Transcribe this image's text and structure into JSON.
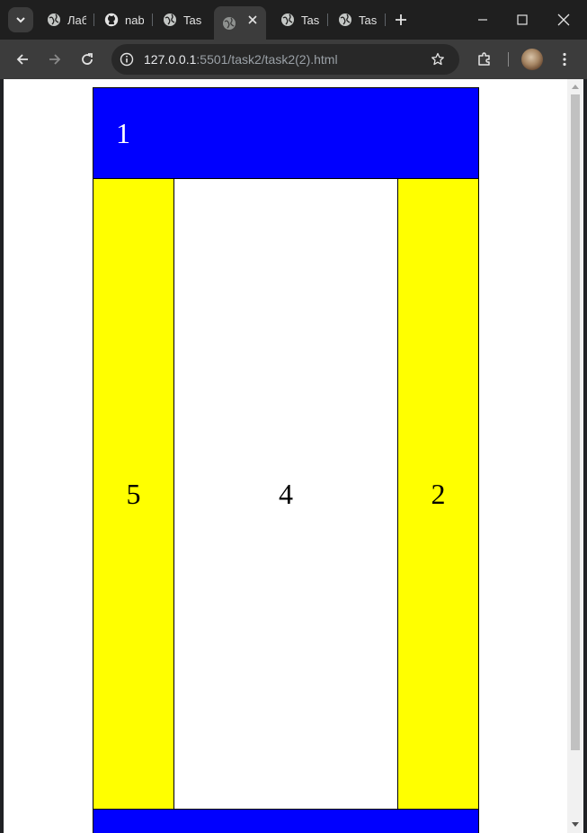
{
  "tabs": [
    {
      "label": "Лаб",
      "icon": "globe-icon"
    },
    {
      "label": "nab",
      "icon": "github-icon"
    },
    {
      "label": "Tasl",
      "icon": "globe-icon"
    },
    {
      "label": "",
      "icon": "globe-icon",
      "active": true
    },
    {
      "label": "Tas",
      "icon": "globe-icon"
    },
    {
      "label": "Tas",
      "icon": "globe-icon"
    }
  ],
  "address_bar": {
    "host": "127.0.0.1",
    "path": ":5501/task2/task2(2).html"
  },
  "page": {
    "block_1": "1",
    "block_5": "5",
    "block_4": "4",
    "block_2": "2",
    "block_3": ""
  },
  "colors": {
    "header_footer": "#0000ff",
    "side_columns": "#ffff00",
    "center": "#ffffff"
  }
}
